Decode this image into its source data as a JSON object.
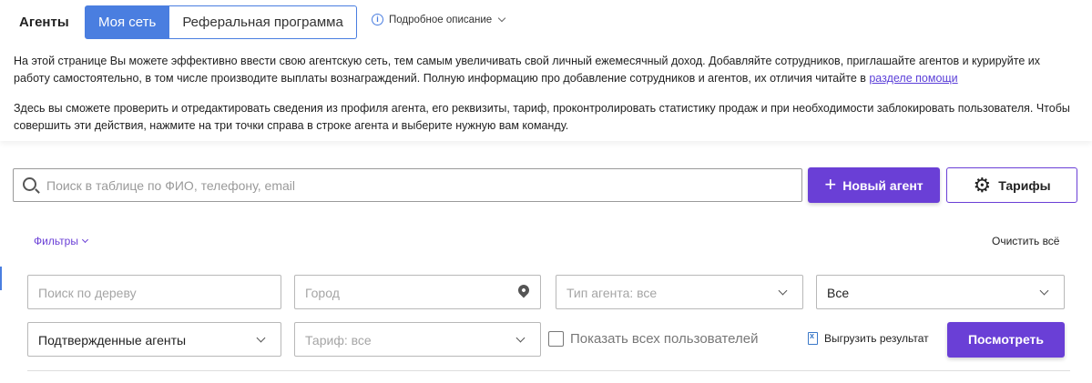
{
  "header": {
    "title": "Агенты",
    "tabs": [
      {
        "label": "Моя сеть",
        "active": true
      },
      {
        "label": "Реферальная программа",
        "active": false
      }
    ],
    "details_link": "Подробное описание"
  },
  "description": {
    "paragraph1": "На этой странице Вы можете эффективно ввести свою агентскую сеть, тем самым увеличивать свой личный ежемесячный доход. Добавляйте сотрудников, приглашайте агентов и курируйте их работу самостоятельно, в том числе производите выплаты вознаграждений. Полную информацию про добавление сотрудников и агентов, их отличия читайте в ",
    "help_link": "разделе помощи",
    "paragraph2": "Здесь вы сможете проверить и отредактировать сведения из профиля агента, его реквизиты, тариф, проконтролировать статистику продаж и при необходимости заблокировать пользователя. Чтобы совершить эти действия, нажмите на три точки справа в строке агента и выберите нужную вам команду."
  },
  "search": {
    "placeholder": "Поиск в таблице по ФИО, телефону, email"
  },
  "actions": {
    "new_agent": "Новый агент",
    "tariffs": "Тарифы"
  },
  "filters": {
    "toggle_label": "Фильтры",
    "clear_all": "Очистить всё",
    "tree_placeholder": "Поиск по дереву",
    "city_placeholder": "Город",
    "agent_type_placeholder": "Тип агента: все",
    "all_select_value": "Все",
    "confirmed_select_value": "Подтвержденные агенты",
    "tariff_placeholder": "Тариф: все",
    "show_all_users_label": "Показать всех пользователей",
    "show_all_users_checked": false,
    "export_label": "Выгрузить результат",
    "view_button": "Посмотреть"
  },
  "colors": {
    "primary_purple": "#6a3fd6",
    "tab_blue": "#4a7ee0",
    "link_purple": "#5b3fd8"
  }
}
